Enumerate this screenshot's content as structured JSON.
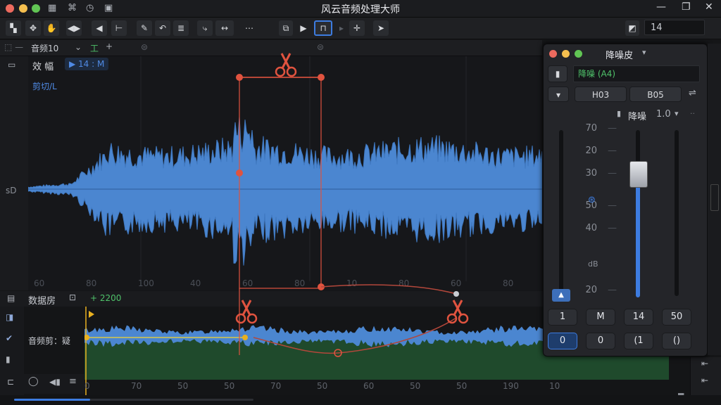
{
  "window": {
    "title": "风云音频处理大师",
    "dots": [
      "#ed6a5e",
      "#f5bf4f",
      "#61c554"
    ],
    "win_icons": [
      "minimize-icon",
      "maximize-icon",
      "close-icon"
    ]
  },
  "toolbar": {
    "zoom_value": "14",
    "accent": "#3d7ce0"
  },
  "track": {
    "tab_label": "音频10",
    "tab_label2": "工",
    "tab_add": "+",
    "name": "效 幅",
    "time": "▶ 14 : M",
    "sub_label": "剪切/L",
    "channel_label": "sD"
  },
  "wave_axis": [
    "60",
    "80",
    "100",
    "40",
    "60",
    "80",
    "10",
    "80",
    "60",
    "80"
  ],
  "lower": {
    "title": "数据房",
    "counter": "+ 2200",
    "track_label": "音频剪：疑"
  },
  "lower_axis": [
    "0",
    "70",
    "50",
    "50",
    "70",
    "50",
    "60",
    "50",
    "50",
    "190",
    "10"
  ],
  "panel": {
    "title": "降噪皮",
    "preset_value": "降噪 (A4)",
    "field_a": "H03",
    "field_b": "B05",
    "section_label": "降噪",
    "section_value": "1.0",
    "scale_left": [
      "70",
      "20",
      "30",
      "50",
      "40",
      "20"
    ],
    "row1": [
      "1",
      "M",
      "14",
      "50"
    ],
    "row2": [
      "0",
      "0",
      "(1",
      "()"
    ]
  },
  "colors": {
    "waveform": "#4b86d0",
    "waveform_dark": "#2c5c9a",
    "selection": "#e0533f",
    "envelope": "#b3473b",
    "green_track": "#2a6a3a",
    "fader_fill": "#3d7ce0"
  }
}
